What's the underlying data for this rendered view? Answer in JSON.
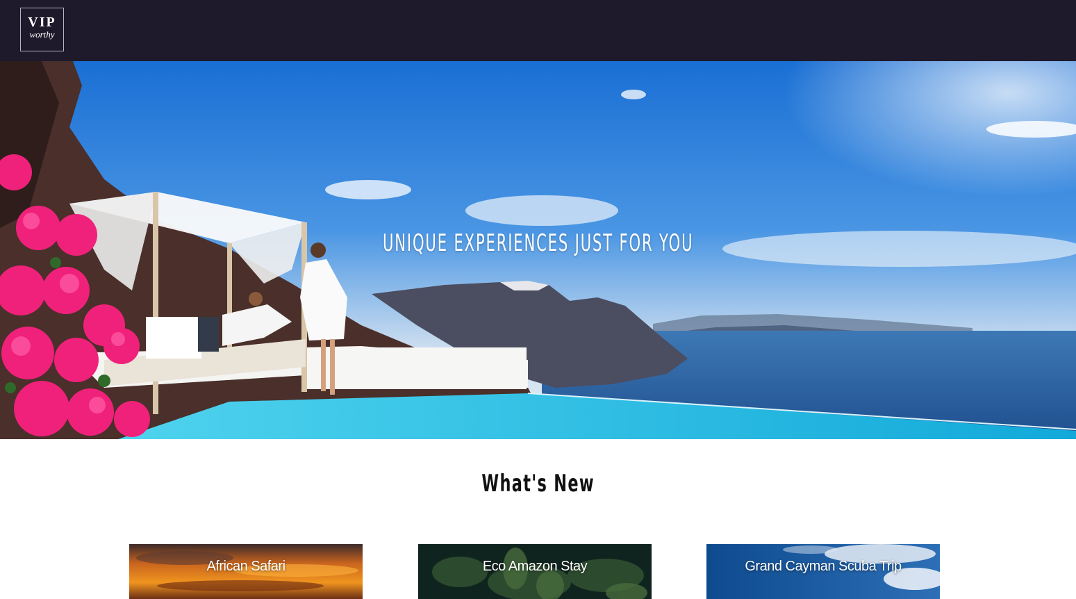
{
  "header": {
    "logo": {
      "line1": "VIP",
      "line2": "worthy"
    }
  },
  "hero": {
    "title": "UNIQUE EXPERIENCES JUST FOR YOU"
  },
  "whats_new": {
    "title": "What's New",
    "cards": [
      {
        "label": "African Safari"
      },
      {
        "label": "Eco Amazon Stay"
      },
      {
        "label": "Grand Cayman Scuba Trip"
      }
    ]
  }
}
